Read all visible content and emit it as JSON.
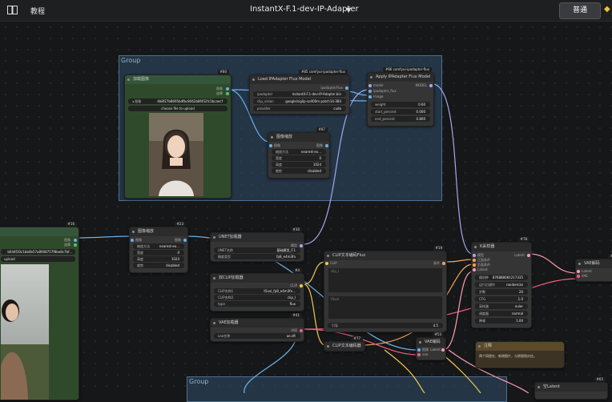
{
  "topbar": {
    "tutorial_label": "教程",
    "workflow_title": "InstantX-F.1-dev-IP-Adapter",
    "mode_button": "普通"
  },
  "groups": [
    {
      "title": "Group"
    },
    {
      "title": "Group"
    }
  ],
  "nodes": {
    "load_image_top": {
      "badge": "#80",
      "title": "加载图像",
      "outputs": [
        "图像",
        "遮罩"
      ],
      "image_value": "4b8f27b8695bdfbc8062b8f452fc5bcaecf",
      "upload_label": "choose file to upload"
    },
    "load_ipadapter": {
      "badge": "#85 comfyui-ipadapter-flux",
      "title": "Load IPAdapter Flux Model",
      "output": "ipadapterFlux",
      "widgets": [
        {
          "label": "ipadapter",
          "value": "InstantX-F.1-dev-IP-Adapter.bin"
        },
        {
          "label": "clip_vision",
          "value": "google/siglip-so400m-patch14-384"
        },
        {
          "label": "provider",
          "value": "cuda"
        }
      ]
    },
    "apply_ipadapter": {
      "badge": "#86 comfyui-ipadapter-flux",
      "title": "Apply IPAdapter Flux Model",
      "inputs": [
        "model",
        "ipadapter_flux",
        "image"
      ],
      "output": "MODEL",
      "widgets": [
        {
          "label": "weight",
          "value": "0.60"
        },
        {
          "label": "start_percent",
          "value": "0.000"
        },
        {
          "label": "end_percent",
          "value": "0.800"
        }
      ]
    },
    "image_scale_top": {
      "badge": "#87",
      "title": "图像缩放",
      "input": "图像",
      "output": "图像",
      "widgets": [
        {
          "label": "缩放方法",
          "value": "nearest-ex..."
        },
        {
          "label": "宽度",
          "value": "0"
        },
        {
          "label": "高度",
          "value": "1024"
        },
        {
          "label": "裁剪",
          "value": "disabled"
        }
      ]
    },
    "load_image_left": {
      "badge": "#16",
      "outputs": [
        "图像",
        "遮罩"
      ],
      "image_value": "b044f20c1bb0b57a8908757f8ba8c7bf...",
      "upload_label": "upload"
    },
    "image_scale_mid": {
      "badge": "#23",
      "title": "图像缩放",
      "input": "图像",
      "output": "图像",
      "widgets": [
        {
          "label": "缩放方法",
          "value": "nearest-ex..."
        },
        {
          "label": "宽度",
          "value": "0"
        },
        {
          "label": "高度",
          "value": "1024"
        },
        {
          "label": "裁剪",
          "value": "disabled"
        }
      ]
    },
    "unet_loader": {
      "badge": "#30",
      "title": "UNET加载器",
      "output": "模型",
      "widgets": [
        {
          "label": "UNET名称",
          "value": "基础模型_F.1"
        },
        {
          "label": "精度类型",
          "value": "fp8_e4m3fn"
        }
      ]
    },
    "dual_clip_loader": {
      "badge": "#4",
      "title": "双CLIP加载器",
      "output": "CLIP",
      "widgets": [
        {
          "label": "CLIP名称1",
          "value": "t5xxl_fp8_e4m3fn..."
        },
        {
          "label": "CLIP名称2",
          "value": "clip_l"
        },
        {
          "label": "type",
          "value": "flux"
        }
      ]
    },
    "vae_loader": {
      "badge": "#41",
      "title": "VAE加载器",
      "output": "VAE",
      "widgets": [
        {
          "label": "vae名称",
          "value": "ae.sft"
        }
      ]
    },
    "clip_text_flux": {
      "badge": "#19",
      "title": "CLIP文本编码Flux",
      "input": "CLIP",
      "output": "条件",
      "text1": "clip_l",
      "text2": "t5xxl",
      "widgets": [
        {
          "label": "引导",
          "value": "4.5"
        }
      ]
    },
    "clip_text_neg": {
      "badge": "#77",
      "title": "CLIP文本编码器"
    },
    "ksampler": {
      "badge": "#78",
      "title": "K采样器",
      "inputs": [
        "模型",
        "正面条件",
        "负面条件",
        "Latent"
      ],
      "output": "Latent",
      "widgets": [
        {
          "label": "随机种",
          "value": "876888081217335"
        },
        {
          "label": "运行后操作",
          "value": "randomize"
        },
        {
          "label": "步数",
          "value": "20"
        },
        {
          "label": "CFG",
          "value": "1.0"
        },
        {
          "label": "采样器",
          "value": "euler"
        },
        {
          "label": "调度器",
          "value": "normal"
        },
        {
          "label": "降噪",
          "value": "1.00"
        }
      ]
    },
    "vae_decode_right": {
      "badge": "#5",
      "title": "VAE解码",
      "inputs": [
        "Latent",
        "VAE"
      ]
    },
    "vae_encode": {
      "badge": "#53",
      "title": "VAE编码",
      "inputs": [
        "图像",
        "vae"
      ],
      "output": "Latent"
    },
    "note": {
      "title": "注释",
      "text": "两个同提在、新增图片，与原图相对应。"
    },
    "empty_latent": {
      "badge": "#65",
      "title": "空Latent"
    }
  }
}
